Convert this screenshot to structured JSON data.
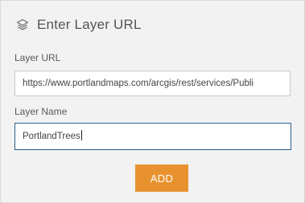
{
  "dialog": {
    "title": "Enter Layer URL",
    "title_icon": "layers-icon"
  },
  "fields": {
    "layer_url": {
      "label": "Layer URL",
      "value": "https://www.portlandmaps.com/arcgis/rest/services/Publi"
    },
    "layer_name": {
      "label": "Layer Name",
      "value": "PortlandTrees"
    }
  },
  "actions": {
    "add_label": "ADD"
  },
  "colors": {
    "panel_bg": "#f2f2f2",
    "accent_button": "#e8922f",
    "focus_border": "#2b5d89"
  }
}
